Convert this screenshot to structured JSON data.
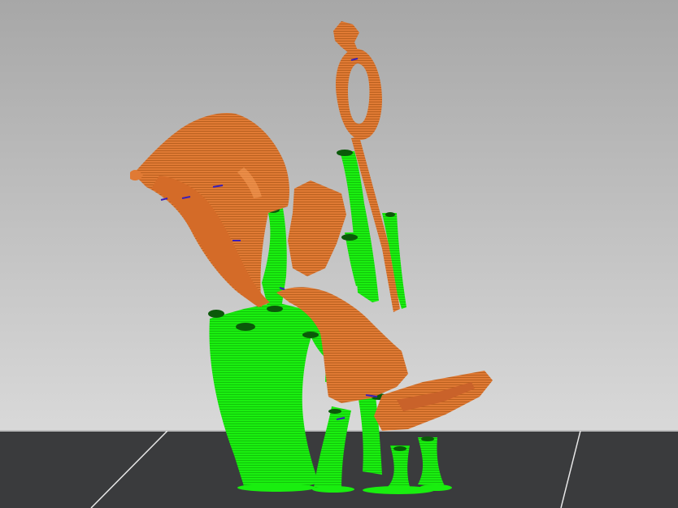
{
  "app": {
    "view": "3d-preview-viewport"
  },
  "scene": {
    "background_top": "#a8a8a8",
    "background_bottom": "#d8d8d8",
    "bed_color": "#3a3b3d",
    "bed_grid_color": "#f2f2f2",
    "model_color": "#e07a34",
    "model_dark": "#b2571d",
    "model_light": "#f39a55",
    "support_color": "#19ee0f",
    "support_dark": "#0fb808",
    "support_shadow": "#0b5a0a",
    "overhang_color": "#3a1fb8"
  },
  "icons": {
    "bed": "build-plate-icon",
    "model": "sliced-model-icon",
    "supports": "support-structure-icon"
  }
}
